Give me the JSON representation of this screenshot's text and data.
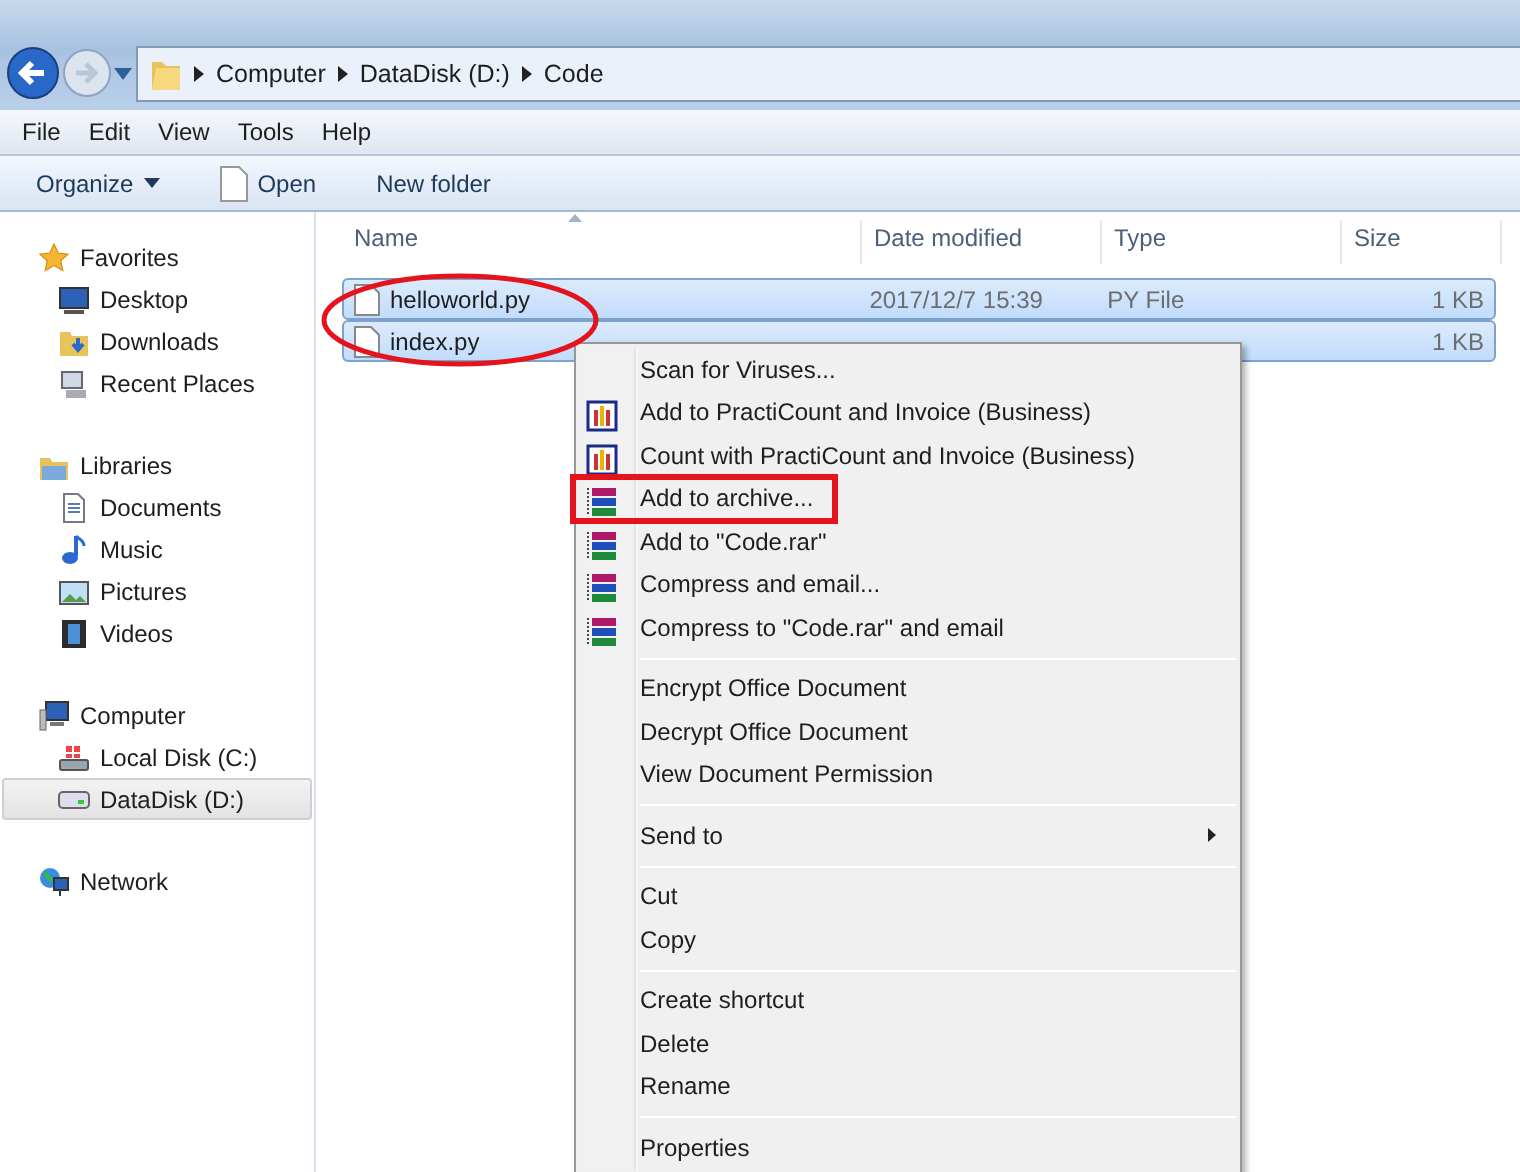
{
  "address": {
    "crumbs": [
      "Computer",
      "DataDisk (D:)",
      "Code"
    ]
  },
  "menu_bar": [
    "File",
    "Edit",
    "View",
    "Tools",
    "Help"
  ],
  "toolbar": [
    {
      "label": "Organize",
      "dropdown": true
    },
    {
      "label": "Open",
      "dropdown": false
    },
    {
      "label": "New folder",
      "dropdown": false
    }
  ],
  "sidebar": [
    {
      "label": "Favorites",
      "selected": false,
      "children": [
        {
          "label": "Desktop",
          "selected": false
        },
        {
          "label": "Downloads",
          "selected": false
        },
        {
          "label": "Recent Places",
          "selected": false
        }
      ]
    },
    {
      "label": "Libraries",
      "selected": false,
      "children": [
        {
          "label": "Documents",
          "selected": false
        },
        {
          "label": "Music",
          "selected": false
        },
        {
          "label": "Pictures",
          "selected": false
        },
        {
          "label": "Videos",
          "selected": false
        }
      ]
    },
    {
      "label": "Computer",
      "selected": false,
      "children": [
        {
          "label": "Local Disk (C:)",
          "selected": false
        },
        {
          "label": "DataDisk (D:)",
          "selected": true
        }
      ]
    },
    {
      "label": "Network",
      "selected": false
    }
  ],
  "table": {
    "columns": [
      {
        "label": "Name",
        "sorted": true
      },
      {
        "label": "Date modified",
        "sorted": false
      },
      {
        "label": "Type",
        "sorted": false
      },
      {
        "label": "Size",
        "sorted": false
      }
    ],
    "circled": true,
    "rows": [
      {
        "name": "helloworld.py",
        "date": "2017/12/7 15:39",
        "type": "PY File",
        "size": "1 KB",
        "selected": true
      },
      {
        "name": "index.py",
        "size": "1 KB",
        "selected": true
      }
    ]
  },
  "context_menu": [
    {
      "kind": "item",
      "label": "Scan for Viruses..."
    },
    {
      "kind": "app-item",
      "label": "Add to PractiCount and Invoice (Business)"
    },
    {
      "kind": "app-item",
      "label": "Count with PractiCount and Invoice (Business)"
    },
    {
      "kind": "archive-item",
      "label": "Add to archive...",
      "outlined": true
    },
    {
      "kind": "archive-item",
      "label": "Add to \"Code.rar\""
    },
    {
      "kind": "archive-item",
      "label": "Compress and email..."
    },
    {
      "kind": "archive-item",
      "label": "Compress to \"Code.rar\" and email"
    },
    {
      "kind": "separator"
    },
    {
      "kind": "item",
      "label": "Encrypt Office Document"
    },
    {
      "kind": "item",
      "label": "Decrypt Office Document"
    },
    {
      "kind": "item",
      "label": "View Document Permission"
    },
    {
      "kind": "separator"
    },
    {
      "kind": "item",
      "label": "Send to",
      "submenu": true
    },
    {
      "kind": "separator"
    },
    {
      "kind": "item",
      "label": "Cut"
    },
    {
      "kind": "item",
      "label": "Copy"
    },
    {
      "kind": "separator"
    },
    {
      "kind": "item",
      "label": "Create shortcut"
    },
    {
      "kind": "item",
      "label": "Delete"
    },
    {
      "kind": "item",
      "label": "Rename"
    },
    {
      "kind": "separator"
    },
    {
      "kind": "item",
      "label": "Properties"
    }
  ]
}
